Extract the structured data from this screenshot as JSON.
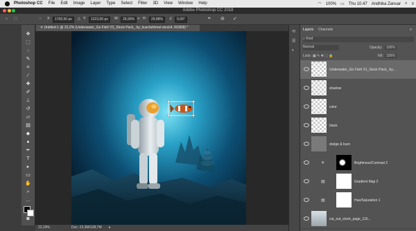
{
  "menubar": {
    "app_name": "Photoshop CC",
    "items": [
      "File",
      "Edit",
      "Image",
      "Layer",
      "Type",
      "Select",
      "Filter",
      "3D",
      "View",
      "Window",
      "Help"
    ],
    "clock": "Thu 10.47",
    "user": "Andhika Zanuar",
    "battery": "100%"
  },
  "window": {
    "title": "Adobe Photoshop CC 2018"
  },
  "options_bar": {
    "x_label": "X:",
    "x_value": "1706,50 px",
    "y_label": "Y:",
    "y_value": "1223,50 px",
    "w_label": "W:",
    "w_value": "29,90%",
    "h_label": "H:",
    "h_value": "29,88%",
    "angle_value": "0,00",
    "angle_unit": "°"
  },
  "document": {
    "tab_label": "Untitled-1 @ 22,2% (Underwater_Go Fish! 01_Stock Pack_ by_kuschelirmel-stock4, RGB/8) *"
  },
  "status_bar": {
    "zoom": "22,24%",
    "doc_info": "Doc: 23,3M/128,7M"
  },
  "layers_panel": {
    "tabs": [
      "Layers",
      "Channels"
    ],
    "filter_label": "Kind",
    "blend_mode": "Normal",
    "opacity_label": "Opacity:",
    "opacity_value": "100%",
    "lock_label": "Lock:",
    "fill_label": "Fill:",
    "fill_value": "100%",
    "layers": [
      {
        "name": "Underwater_Go Fish! 01_Stock Pack_ by...",
        "thumb": "checker",
        "selected": true
      },
      {
        "name": "shadow",
        "thumb": "checker",
        "selected": false
      },
      {
        "name": "color",
        "thumb": "checker",
        "selected": false
      },
      {
        "name": "black",
        "thumb": "checker",
        "selected": false
      },
      {
        "name": "dodge & burn",
        "thumb": "gray",
        "selected": false
      },
      {
        "name": "Brightness/Contrast 2",
        "thumb": "adjust-mask",
        "selected": false
      },
      {
        "name": "Gradient Map 2",
        "thumb": "white",
        "selected": false
      },
      {
        "name": "Hue/Saturation 1",
        "thumb": "white",
        "selected": false
      },
      {
        "name": "cut_out_stock_page_115...",
        "thumb": "photo",
        "selected": false
      }
    ]
  },
  "colors": {
    "accent": "#1f6fd6",
    "panel": "#535353",
    "selected_row": "#6a6a6a"
  },
  "icons": [
    "move-icon",
    "marquee-icon",
    "lasso-icon",
    "quick-select-icon",
    "crop-icon",
    "eyedropper-icon",
    "healing-icon",
    "brush-icon",
    "stamp-icon",
    "history-brush-icon",
    "eraser-icon",
    "gradient-icon",
    "blur-icon",
    "dodge-icon",
    "pen-icon",
    "type-icon",
    "path-select-icon",
    "shape-icon",
    "hand-icon",
    "zoom-icon"
  ]
}
